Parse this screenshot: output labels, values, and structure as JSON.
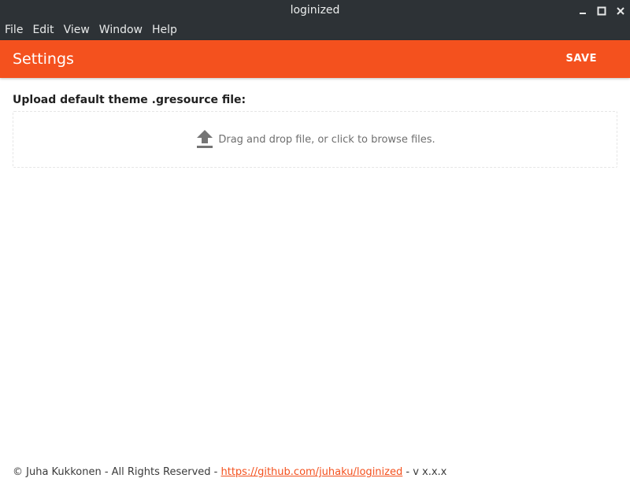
{
  "window": {
    "title": "loginized"
  },
  "menubar": {
    "items": [
      "File",
      "Edit",
      "View",
      "Window",
      "Help"
    ]
  },
  "appbar": {
    "title": "Settings",
    "save_label": "SAVE",
    "color": "#f4511e"
  },
  "upload": {
    "label": "Upload default theme .gresource file:",
    "dropzone_text": "Drag and drop file, or click to browse files.",
    "icon": "upload-icon"
  },
  "footer": {
    "copyright": "© Juha Kukkonen - All Rights Reserved - ",
    "link_text": "https://github.com/juhaku/loginized",
    "version": " - v x.x.x"
  }
}
